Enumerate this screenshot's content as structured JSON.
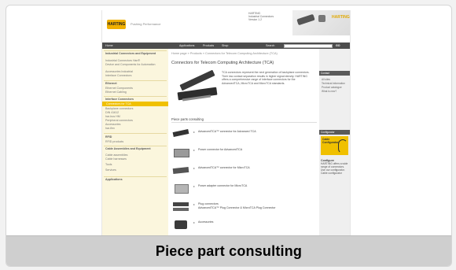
{
  "caption": "Piece part consulting",
  "site": {
    "header": {
      "logo_text": "HARTING",
      "tagline": "Pushing Performance",
      "info_lines": [
        "HARTING",
        "Industrial Connectors",
        "Version 1.2"
      ],
      "banner_badge": "HARTING"
    },
    "nav": {
      "items": [
        "Home",
        "Applications",
        "Products",
        "Shop"
      ],
      "search_label": "Search",
      "go_label": "GO"
    },
    "leftnav": [
      {
        "type": "head",
        "text": "Industrial Connectors and Equipment"
      },
      {
        "type": "item",
        "text": "Industrial Connectors Han®"
      },
      {
        "type": "item",
        "text": "Device and Components for Automation"
      },
      {
        "type": "item",
        "text": "Accessories Industrial"
      },
      {
        "type": "item",
        "text": "Interface Connectors"
      },
      {
        "type": "head",
        "text": "Ethernet"
      },
      {
        "type": "item",
        "text": "Ethernet Components"
      },
      {
        "type": "item",
        "text": "Ethernet Cabling"
      },
      {
        "type": "head",
        "text": "Interface Connectors"
      },
      {
        "type": "selected",
        "text": "Connectors for TCA"
      },
      {
        "type": "item",
        "text": "Backplane connectors"
      },
      {
        "type": "item",
        "text": "DIN 41612"
      },
      {
        "type": "item",
        "text": "har-bus HM"
      },
      {
        "type": "item",
        "text": "Peripheral connectors"
      },
      {
        "type": "item",
        "text": "Accessories"
      },
      {
        "type": "item",
        "text": "har-flex"
      },
      {
        "type": "head",
        "text": "RFID"
      },
      {
        "type": "item",
        "text": "RFID products"
      },
      {
        "type": "head",
        "text": "Cable Assemblies and Equipment"
      },
      {
        "type": "item",
        "text": "Cable assemblies"
      },
      {
        "type": "item",
        "text": "Cable harnesses"
      },
      {
        "type": "item",
        "text": "Tools"
      },
      {
        "type": "item",
        "text": "Services"
      },
      {
        "type": "head",
        "text": "Applications"
      }
    ],
    "main": {
      "breadcrumb": "Home page » Products » Connectors for Telecom Computing Architecture (TCA)",
      "title": "Connectors for Telecom Computing Architecture (TCA)",
      "intro": "TCA connectors represent the next generation of backplane connectors. Their low contact separation results in higher signal density. HARTING offers a comprehensive range of interface connectors for the AdvancedTCA, MicroTCA and MicroTCA standards.",
      "section_title": "Piece parts consulting",
      "rows": [
        {
          "label": "AdvancedTCA™ connector for Advanced TCA",
          "sub": ""
        },
        {
          "label": "Power connector for AdvancedTCA",
          "sub": ""
        },
        {
          "label": "AdvancedTCA™ connector for MicroTCA",
          "sub": ""
        },
        {
          "label": "Power adapter connector for MicroTCA",
          "sub": ""
        },
        {
          "label": "Plug connectors",
          "sub": "AdvancedTCA™ Plug Connector & MicroTCA Plug Connector"
        },
        {
          "label": "Accessories",
          "sub": ""
        }
      ]
    },
    "sidebar": {
      "head1": "Contact",
      "links": [
        "All sites",
        "Technical information",
        "Product catalogue",
        "What is new?"
      ],
      "head2": "Configurator",
      "cta_text": "Cable Configurator",
      "cfg_title": "Configure",
      "cfg_text": "HARTING offers a wide range of connectors. Use our configurator.",
      "cfg_link": "Cable configurator"
    }
  }
}
